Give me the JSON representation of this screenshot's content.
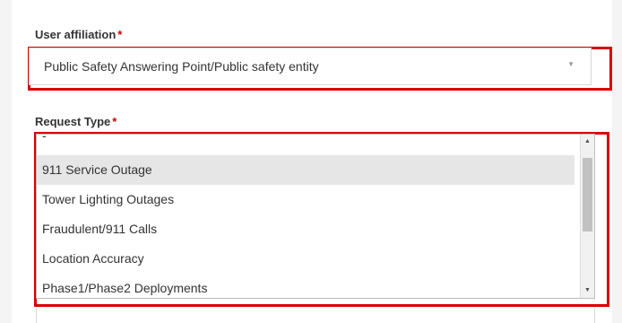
{
  "affiliation": {
    "label": "User affiliation",
    "required_mark": "*",
    "selected_value": "Public Safety Answering Point/Public safety entity"
  },
  "request_type": {
    "label": "Request Type",
    "required_mark": "*",
    "blank_option": "-",
    "options": [
      "911 Service Outage",
      "Tower Lighting Outages",
      "Fraudulent/911 Calls",
      "Location Accuracy",
      "Phase1/Phase2 Deployments"
    ],
    "highlighted_option": "911 Service Outage"
  },
  "colors": {
    "highlight_border": "#d90000",
    "required_asterisk": "#c00000",
    "selected_option_bg": "#e6e6e6"
  },
  "icons": {
    "dropdown_caret": "chevron-down-icon",
    "scroll_up": "scroll-up-arrow-icon",
    "scroll_down": "scroll-down-arrow-icon"
  }
}
